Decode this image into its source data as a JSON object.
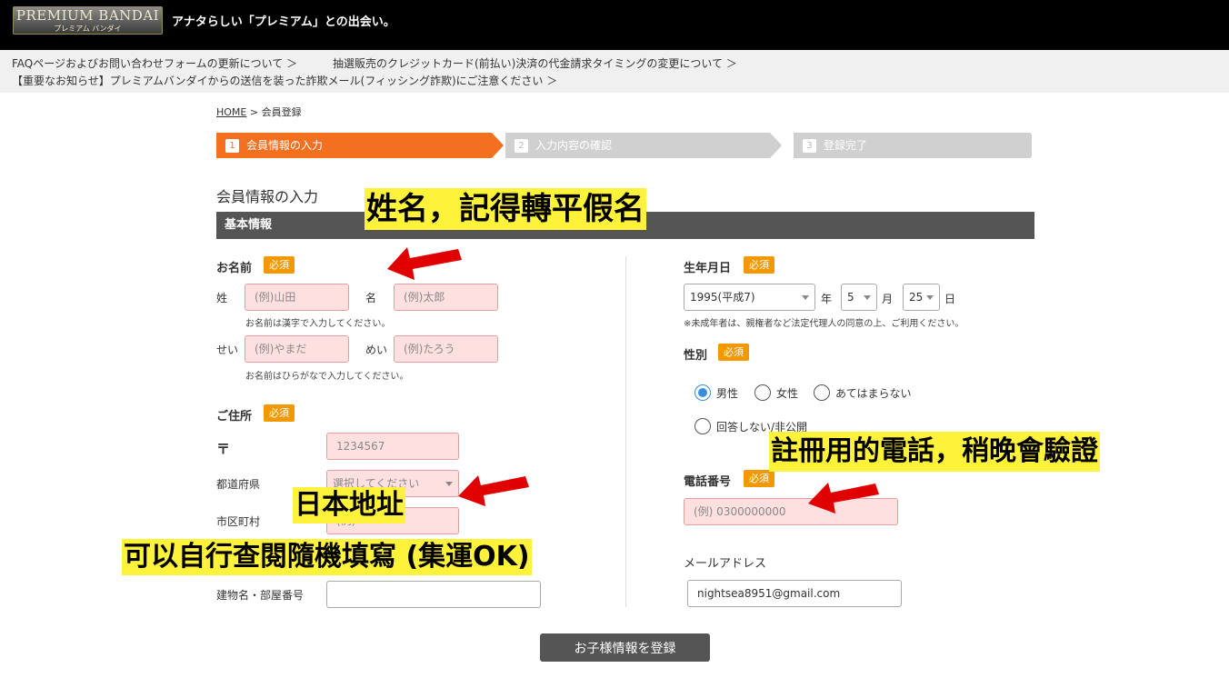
{
  "header": {
    "logo_line1": "PREMIUM BANDAI",
    "logo_line2": "プレミアム バンダイ",
    "tagline": "アナタらしい「プレミアム」との出会い。"
  },
  "notices": [
    "FAQページおよびお問い合わせフォームの更新について ＞",
    "抽選販売のクレジットカード(前払い)決済の代金請求タイミングの変更について ＞",
    "【重要なお知らせ】プレミアムバンダイからの送信を装った詐欺メール(フィッシング詐欺)にご注意ください ＞"
  ],
  "breadcrumb": {
    "home": "HOME",
    "sep": " > ",
    "current": "会員登録"
  },
  "steps": [
    {
      "num": "1",
      "label": "会員情報の入力"
    },
    {
      "num": "2",
      "label": "入力内容の確認"
    },
    {
      "num": "3",
      "label": "登録完了"
    }
  ],
  "section_title": "会員情報の入力",
  "basic_info": "基本情報",
  "required": "必須",
  "name": {
    "title": "お名前",
    "sei_label": "姓",
    "sei_placeholder": "(例)山田",
    "mei_label": "名",
    "mei_placeholder": "(例)太郎",
    "kanji_hint": "お名前は漢字で入力してください。",
    "sei_kana_label": "せい",
    "sei_kana_placeholder": "(例)やまだ",
    "mei_kana_label": "めい",
    "mei_kana_placeholder": "(例)たろう",
    "kana_hint": "お名前はひらがなで入力してください。"
  },
  "address": {
    "title": "ご住所",
    "postal_symbol": "〒",
    "postal_placeholder": "1234567",
    "prefecture_label": "都道府県",
    "prefecture_value": "選択してください",
    "city_label": "市区町村",
    "city_placeholder": "(例)",
    "building_label": "建物名・部屋番号"
  },
  "birth": {
    "title": "生年月日",
    "year": "1995(平成7)",
    "year_unit": "年",
    "month": "5",
    "month_unit": "月",
    "day": "25",
    "day_unit": "日",
    "hint": "※未成年者は、親権者など法定代理人の同意の上、ご利用ください。"
  },
  "gender": {
    "title": "性別",
    "options": [
      "男性",
      "女性",
      "あてはまらない",
      "回答しない/非公開"
    ],
    "selected": "男性"
  },
  "phone": {
    "title": "電話番号",
    "placeholder": "(例) 0300000000"
  },
  "email": {
    "title": "メールアドレス",
    "value": "nightsea8951@gmail.com"
  },
  "submit_label": "お子様情報を登録",
  "annotations": {
    "name_note": "姓名，記得轉平假名",
    "address_note": "日本地址",
    "address_note2": "可以自行查閱隨機填寫 (集運OK)",
    "phone_note": "註冊用的電話，稍晚會驗證"
  },
  "colors": {
    "accent": "#f37021",
    "required": "#f39800",
    "annotation_bg": "#fff23b",
    "arrow": "#e00000"
  }
}
